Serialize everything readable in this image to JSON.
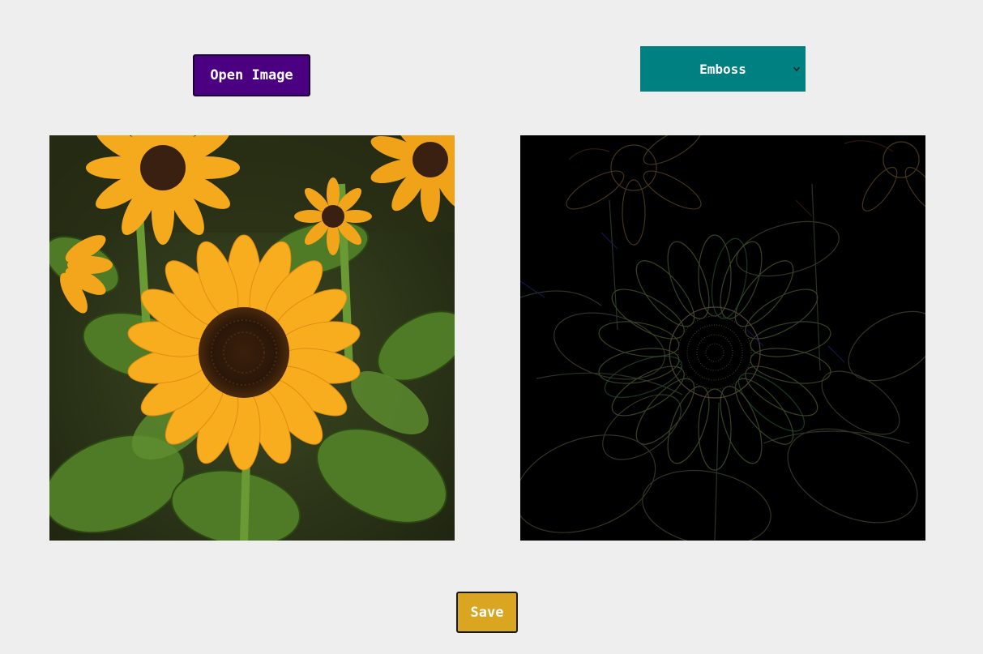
{
  "toolbar": {
    "open_label": "Open Image",
    "filter_selected": "Emboss",
    "save_label": "Save"
  },
  "colors": {
    "open_button_bg": "#4b0082",
    "filter_select_bg": "#008080",
    "save_button_bg": "#daa520",
    "page_bg": "#eeeeee"
  },
  "images": {
    "original": "sunflower-photo",
    "filtered": "sunflower-emboss-result"
  }
}
